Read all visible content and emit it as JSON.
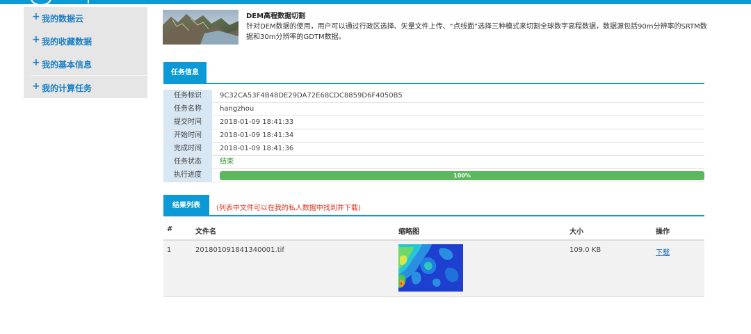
{
  "sidebar": {
    "items": [
      {
        "label": "我的数据云"
      },
      {
        "label": "我的收藏数据"
      },
      {
        "label": "我的基本信息"
      },
      {
        "label": "我的计算任务"
      }
    ]
  },
  "product": {
    "title": "DEM高程数据切割",
    "description": "针对DEM数据的使用，用户可以通过行政区选择、矢量文件上传、“点线面”选择三种模式来切割全球数字高程数据，数据源包括90m分辨率的SRTM数据和30m分辨率的GDTM数据。"
  },
  "task_info": {
    "tab_label": "任务信息",
    "rows": [
      {
        "label": "任务标识",
        "value": "9C32CA53F4B48DE29DA72E68CDC8859D6F4050B5"
      },
      {
        "label": "任务名称",
        "value": "hangzhou"
      },
      {
        "label": "提交时间",
        "value": "2018-01-09 18:41:33"
      },
      {
        "label": "开始时间",
        "value": "2018-01-09 18:41:34"
      },
      {
        "label": "完成时间",
        "value": "2018-01-09 18:41:36"
      },
      {
        "label": "任务状态",
        "value": "结束"
      },
      {
        "label": "执行进度",
        "value": "100%"
      }
    ],
    "progress_fraction": 1.0
  },
  "results": {
    "tab_label": "结果列表",
    "note": "(列表中文件可以在我的私人数据中找到并下载)",
    "columns": [
      "#",
      "文件名",
      "缩略图",
      "大小",
      "操作"
    ],
    "rows": [
      {
        "index": "1",
        "filename": "201801091841340001.tif",
        "size": "109.0 KB",
        "action": "下载"
      }
    ]
  },
  "colors": {
    "accent": "#0b9ad6",
    "sidebar_text": "#1a7fc4",
    "progress": "#5cb85c",
    "status_green": "#2f9a2f",
    "note_red": "#e0321e"
  }
}
